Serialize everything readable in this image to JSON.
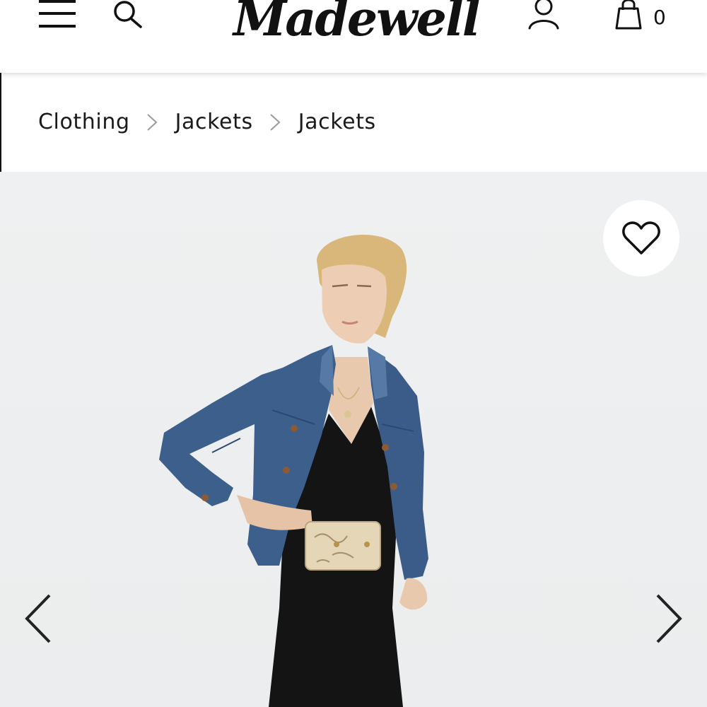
{
  "header": {
    "logo_text": "Madewell",
    "bag_count": "0",
    "icons": [
      "menu-icon",
      "search-icon",
      "account-icon",
      "shopping-bag-icon"
    ]
  },
  "breadcrumb": {
    "items": [
      {
        "label": "Clothing"
      },
      {
        "label": "Jackets"
      },
      {
        "label": "Jackets"
      }
    ],
    "separator_icon": "chevron-right-icon"
  },
  "product_gallery": {
    "image_alt": "Model wearing a medium-wash denim jean jacket over a black slip dress with a snakeskin belt bag",
    "favorite_icon": "heart-outline-icon",
    "prev_icon": "chevron-left-icon",
    "next_icon": "chevron-right-icon"
  },
  "colors": {
    "text": "#1a1a1a",
    "background": "#ffffff",
    "hero_background": "#eceeef",
    "denim": "#3d5f8c"
  }
}
